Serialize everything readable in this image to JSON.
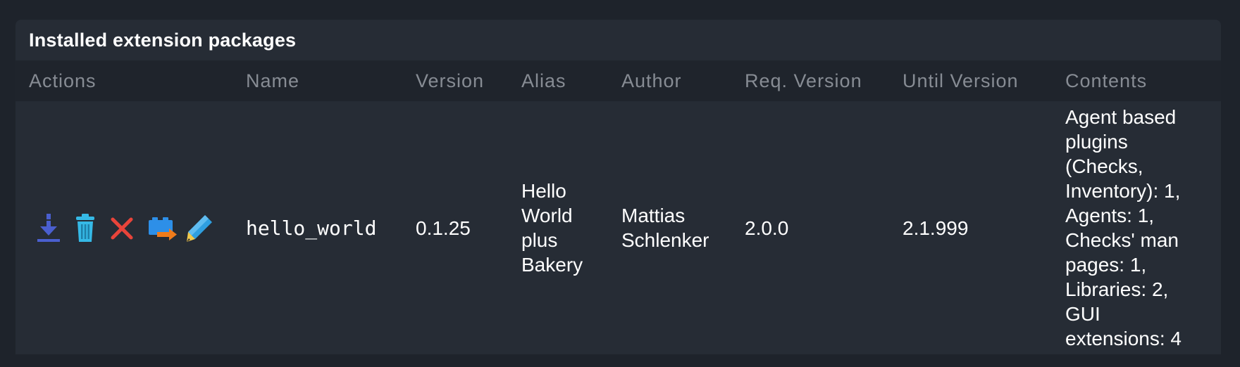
{
  "panel": {
    "title": "Installed extension packages"
  },
  "columns": {
    "actions": "Actions",
    "name": "Name",
    "version": "Version",
    "alias": "Alias",
    "author": "Author",
    "req_version": "Req. Version",
    "until_version": "Until Version",
    "contents": "Contents"
  },
  "row": {
    "actions": [
      {
        "icon": "download-icon",
        "color": "#4a5fcf"
      },
      {
        "icon": "trash-icon",
        "color": "#35b9e6"
      },
      {
        "icon": "close-icon",
        "color": "#e8443a"
      },
      {
        "icon": "mkp-package-icon",
        "color": "#2d8fe8"
      },
      {
        "icon": "edit-pencil-icon",
        "color": "#2f9fe0"
      }
    ],
    "name": "hello_world",
    "version": "0.1.25",
    "alias_lines": [
      "Hello",
      "World",
      "plus",
      "Bakery"
    ],
    "author_lines": [
      "Mattias",
      "Schlenker"
    ],
    "req_version": "2.0.0",
    "until_version": "2.1.999",
    "contents_lines": [
      "Agent based",
      "plugins",
      "(Checks,",
      "Inventory): 1,",
      "Agents: 1,",
      "Checks' man",
      "pages: 1,",
      "Libraries: 2,",
      "GUI",
      "extensions: 4"
    ]
  }
}
